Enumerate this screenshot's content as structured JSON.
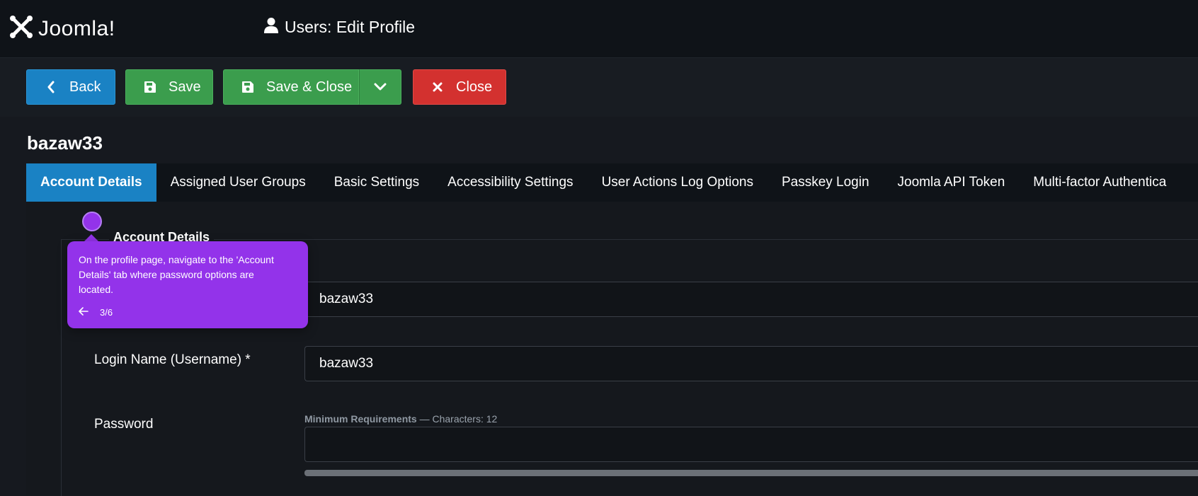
{
  "header": {
    "logo_text": "Joomla!",
    "page_title": "Users: Edit Profile"
  },
  "toolbar": {
    "back_label": "Back",
    "save_label": "Save",
    "save_close_label": "Save & Close",
    "close_label": "Close"
  },
  "record": {
    "title": "bazaw33"
  },
  "tabs": [
    {
      "label": "Account Details",
      "active": true
    },
    {
      "label": "Assigned User Groups"
    },
    {
      "label": "Basic Settings"
    },
    {
      "label": "Accessibility Settings"
    },
    {
      "label": "User Actions Log Options"
    },
    {
      "label": "Passkey Login"
    },
    {
      "label": "Joomla API Token"
    },
    {
      "label": "Multi-factor Authentica"
    }
  ],
  "form": {
    "legend": "Account Details",
    "name_value": "bazaw33",
    "login_label": "Login Name (Username) *",
    "login_value": "bazaw33",
    "password_label": "Password",
    "password_hint_bold": "Minimum Requirements",
    "password_hint_rest": " — Characters: 12",
    "password_value": ""
  },
  "tour": {
    "text": "On the profile page, navigate to the 'Account Details' tab where password options are located.",
    "step": "3/6"
  },
  "colors": {
    "accent_blue": "#1a82c4",
    "save_green": "#3b9d4d",
    "close_red": "#d3312f",
    "tour_purple": "#9333ea"
  }
}
